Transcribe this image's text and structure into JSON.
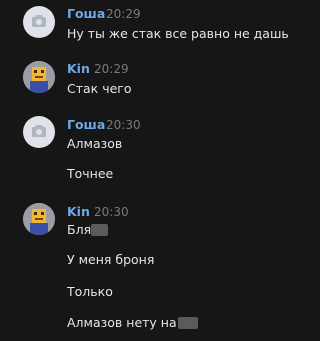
{
  "messages": [
    {
      "author": "Гоша",
      "time": "20:29",
      "avatar": "camera-placeholder-icon",
      "lines": [
        "Ну ты же стак все равно не дашь"
      ]
    },
    {
      "author": "Kin",
      "time": "20:29",
      "avatar": "pixel-character-avatar",
      "lines": [
        "Стак чего"
      ]
    },
    {
      "author": "Гоша",
      "time": "20:30",
      "avatar": "camera-placeholder-icon",
      "lines": [
        "Алмазов",
        "Точнее"
      ]
    },
    {
      "author": "Kin",
      "time": "20:30",
      "avatar": "pixel-character-avatar",
      "lines": [
        "Бля",
        "У меня броня",
        "Только",
        "Алмазов нету на"
      ]
    }
  ],
  "colors": {
    "background": "#161616",
    "author": "#6fa8e8",
    "time": "#7a7a7a",
    "text": "#e6e6e6",
    "redaction": "#5b5b5b"
  }
}
